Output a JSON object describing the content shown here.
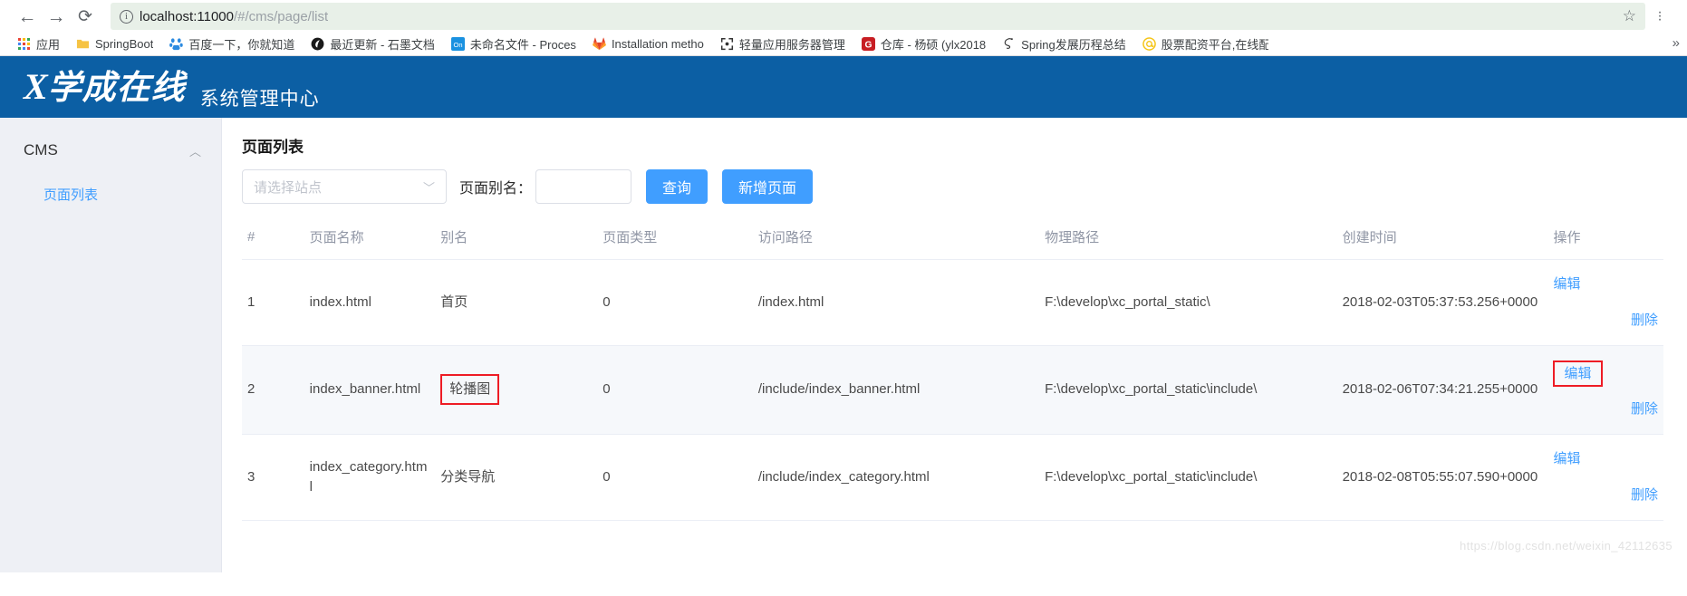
{
  "browser": {
    "back_icon": "←",
    "forward_icon": "→",
    "reload_icon": "⟳",
    "url_host": "localhost:11000",
    "url_path": "/#/cms/page/list",
    "star_icon": "☆",
    "menu_icon": "kebab-menu-icon",
    "overflow_icon": "»",
    "bookmarks": [
      {
        "label": "应用",
        "icon": "apps-grid-icon"
      },
      {
        "label": "SpringBoot",
        "icon": "folder-icon"
      },
      {
        "label": "百度一下，你就知道",
        "icon": "baidu-icon"
      },
      {
        "label": "最近更新 - 石墨文档",
        "icon": "shimo-icon"
      },
      {
        "label": "未命名文件 - Proces",
        "icon": "on-icon"
      },
      {
        "label": "Installation metho",
        "icon": "gitlab-icon"
      },
      {
        "label": "轻量应用服务器管理",
        "icon": "brackets-icon"
      },
      {
        "label": "仓库 - 杨硕 (ylx2018",
        "icon": "g-icon"
      },
      {
        "label": "Spring发展历程总结",
        "icon": "spring-icon"
      },
      {
        "label": "股票配资平台,在线配",
        "icon": "at-icon"
      }
    ]
  },
  "header": {
    "logo_mark": "X",
    "logo_text": "学成在线",
    "subtitle": "系统管理中心"
  },
  "sidebar": {
    "group_label": "CMS",
    "collapse_icon": "chevron-up-icon",
    "items": [
      {
        "label": "页面列表"
      }
    ]
  },
  "main": {
    "title": "页面列表",
    "filter": {
      "site_placeholder": "请选择站点",
      "site_value": "",
      "dropdown_icon": "chevron-down-icon",
      "alias_label": "页面别名：",
      "alias_value": "",
      "alias_placeholder": "",
      "search_button": "查询",
      "add_button": "新增页面"
    },
    "table": {
      "columns": [
        "#",
        "页面名称",
        "别名",
        "页面类型",
        "访问路径",
        "物理路径",
        "创建时间",
        "操作"
      ],
      "rows": [
        {
          "index": "1",
          "name": "index.html",
          "alias": "首页",
          "alias_highlighted": false,
          "type": "0",
          "path": "/index.html",
          "physical": "F:\\develop\\xc_portal_static\\",
          "created": "2018-02-03T05:37:53.256+0000",
          "edit": "编辑",
          "edit_highlighted": false,
          "delete": "删除"
        },
        {
          "index": "2",
          "name": "index_banner.html",
          "alias": "轮播图",
          "alias_highlighted": true,
          "type": "0",
          "path": "/include/index_banner.html",
          "physical": "F:\\develop\\xc_portal_static\\include\\",
          "created": "2018-02-06T07:34:21.255+0000",
          "edit": "编辑",
          "edit_highlighted": true,
          "delete": "删除"
        },
        {
          "index": "3",
          "name": "index_category.html",
          "alias": "分类导航",
          "alias_highlighted": false,
          "type": "0",
          "path": "/include/index_category.html",
          "physical": "F:\\develop\\xc_portal_static\\include\\",
          "created": "2018-02-08T05:55:07.590+0000",
          "edit": "编辑",
          "edit_highlighted": false,
          "delete": "删除"
        }
      ]
    }
  },
  "watermark": "https://blog.csdn.net/weixin_42112635",
  "colors": {
    "header_blue": "#0c5fa4",
    "accent_blue": "#409eff",
    "highlight_red": "#ee1c25",
    "sidebar_bg": "#eef0f5"
  }
}
